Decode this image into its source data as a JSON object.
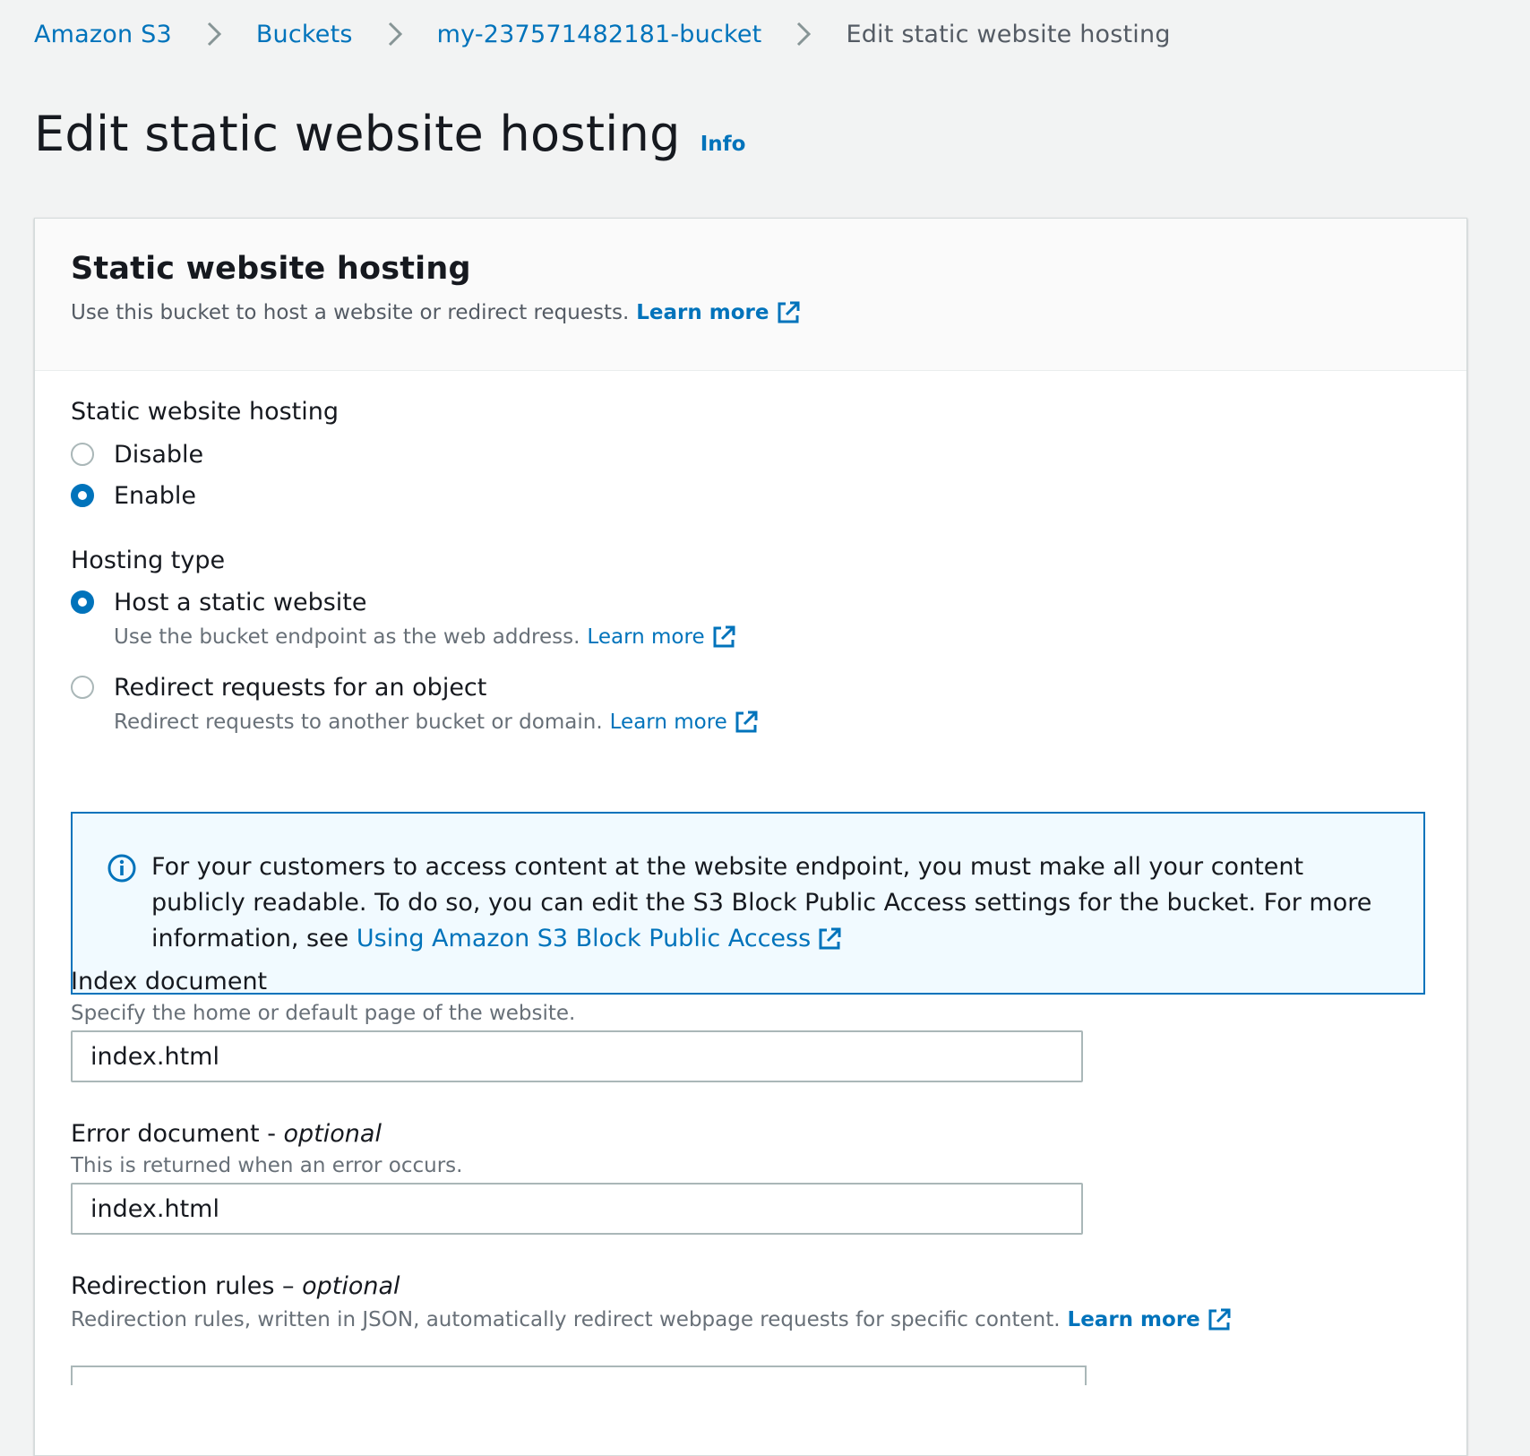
{
  "breadcrumb": {
    "items": [
      "Amazon S3",
      "Buckets",
      "my-237571482181-bucket"
    ],
    "current": "Edit static website hosting"
  },
  "page": {
    "title": "Edit static website hosting",
    "info_label": "Info"
  },
  "panel": {
    "title": "Static website hosting",
    "description": "Use this bucket to host a website or redirect requests.",
    "learn_more": "Learn more"
  },
  "hosting_toggle": {
    "label": "Static website hosting",
    "options": [
      {
        "label": "Disable",
        "selected": false
      },
      {
        "label": "Enable",
        "selected": true
      }
    ]
  },
  "hosting_type": {
    "label": "Hosting type",
    "options": [
      {
        "label": "Host a static website",
        "description": "Use the bucket endpoint as the web address.",
        "learn_more": "Learn more",
        "selected": true
      },
      {
        "label": "Redirect requests for an object",
        "description": "Redirect requests to another bucket or domain.",
        "learn_more": "Learn more",
        "selected": false
      }
    ]
  },
  "alert": {
    "text": "For your customers to access content at the website endpoint, you must make all your content publicly readable. To do so, you can edit the S3 Block Public Access settings for the bucket. For more information, see",
    "link": "Using Amazon S3 Block Public Access"
  },
  "index_document": {
    "label": "Index document",
    "description": "Specify the home or default page of the website.",
    "value": "index.html"
  },
  "error_document": {
    "label": "Error document - ",
    "optional": "optional",
    "description": "This is returned when an error occurs.",
    "value": "index.html"
  },
  "redirection_rules": {
    "label": "Redirection rules – ",
    "optional": "optional",
    "description": "Redirection rules, written in JSON, automatically redirect webpage requests for specific content.",
    "learn_more": "Learn more"
  },
  "colors": {
    "link": "#0073bb",
    "background": "#f2f3f3",
    "alert_bg": "#f1faff"
  }
}
